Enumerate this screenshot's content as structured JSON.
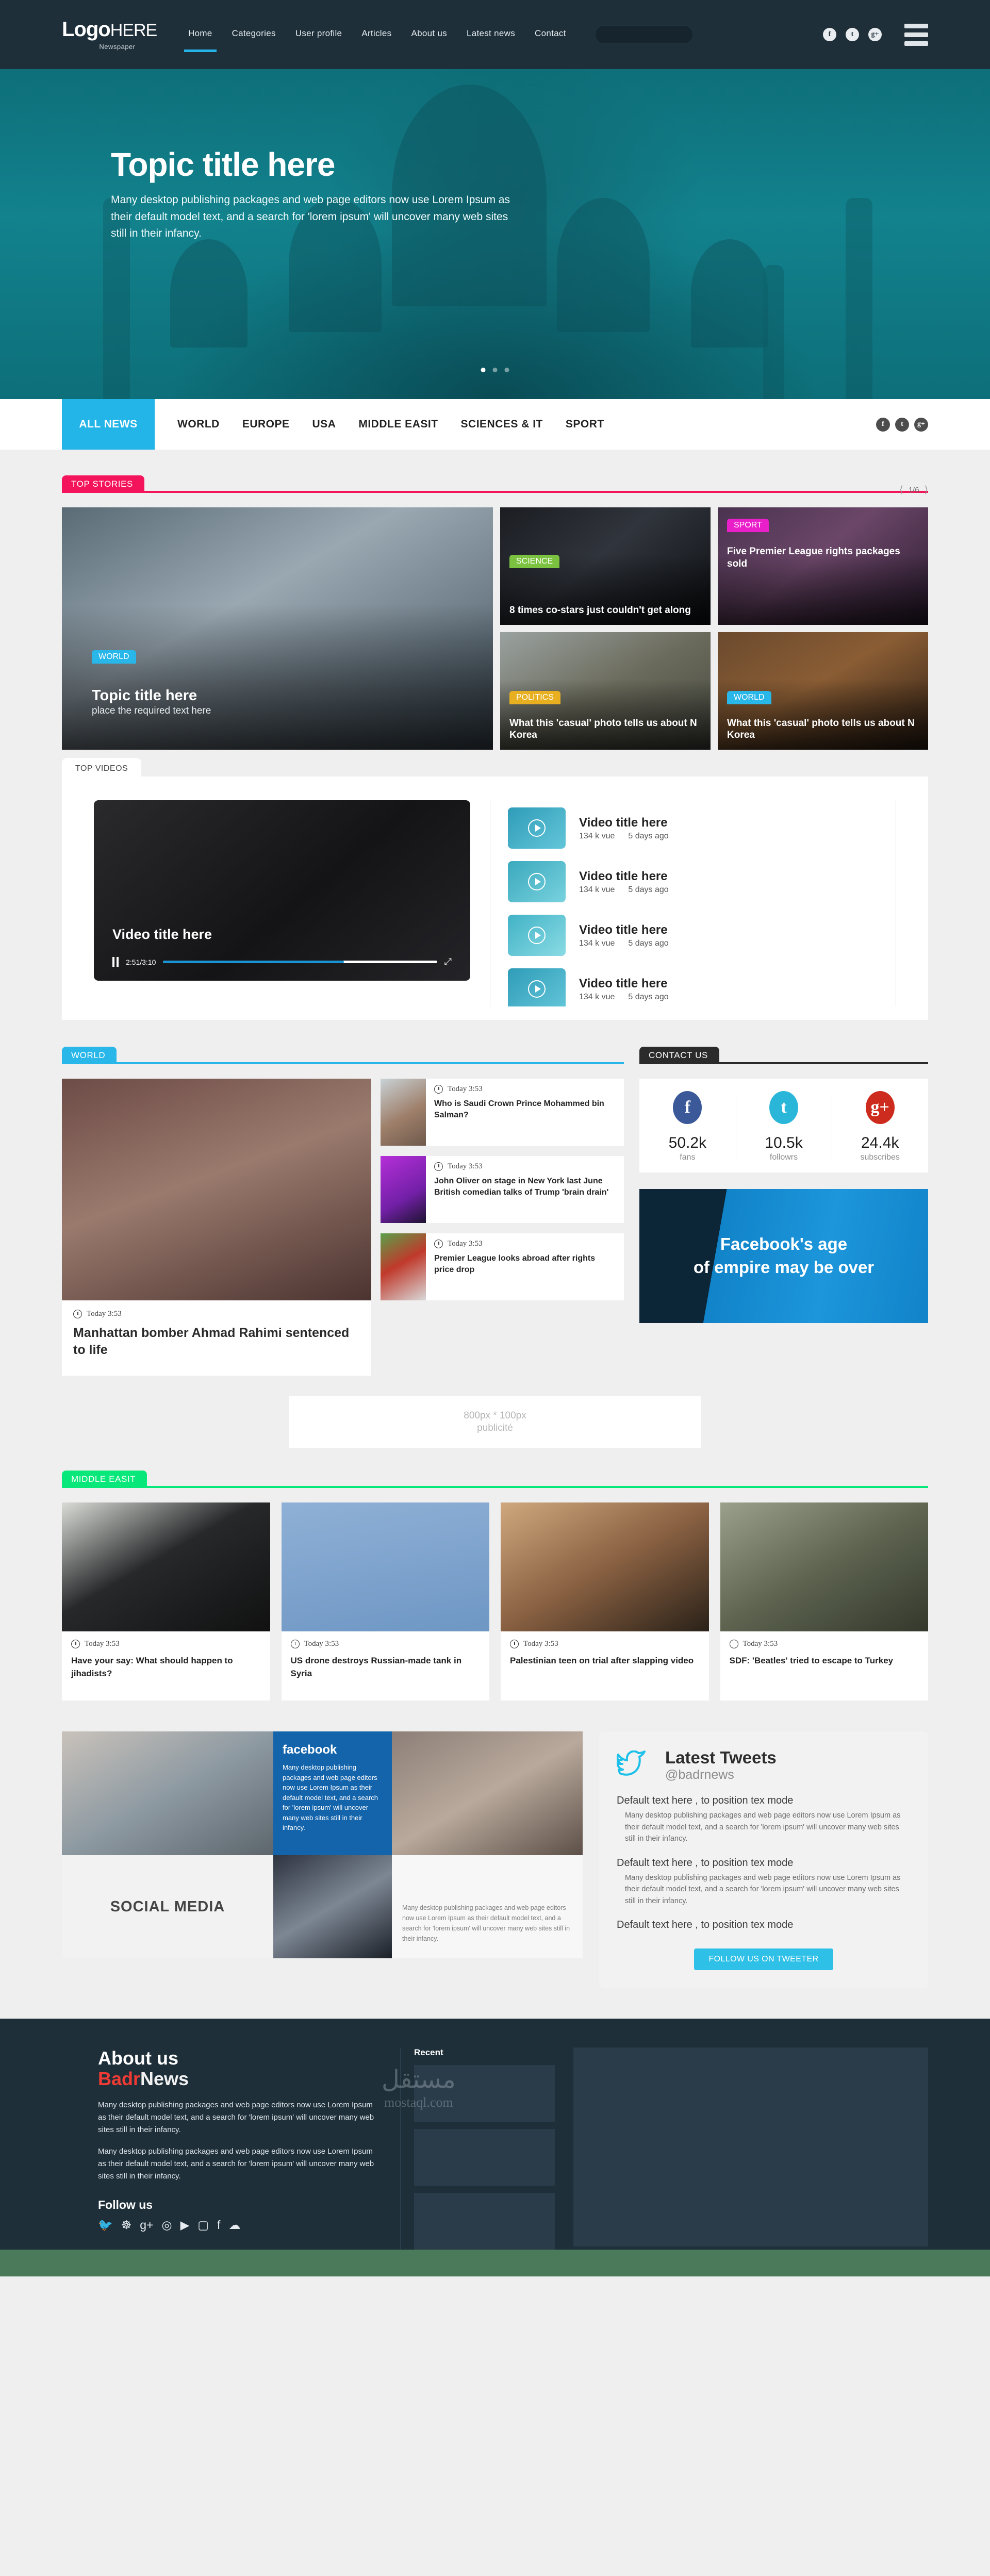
{
  "header": {
    "logo_main": "Logo",
    "logo_main_light": "HERE",
    "logo_sub": "Newspaper",
    "nav": [
      {
        "label": "Home",
        "active": true
      },
      {
        "label": "Categories",
        "active": false
      },
      {
        "label": "User profile",
        "active": false
      },
      {
        "label": "Articles",
        "active": false
      },
      {
        "label": "About us",
        "active": false
      },
      {
        "label": "Latest news",
        "active": false
      },
      {
        "label": "Contact",
        "active": false
      }
    ],
    "search_placeholder": "",
    "socials": [
      "f",
      "t",
      "g+"
    ]
  },
  "hero": {
    "title": "Topic title here",
    "text": "Many desktop publishing packages and web page editors now use Lorem Ipsum  as their default model text, and a search  for 'lorem ipsum' will uncover many web sites still in their infancy.",
    "dots": 3,
    "active_dot": 0
  },
  "categorybar": {
    "active": "ALL NEWS",
    "items": [
      "WORLD",
      "EUROPE",
      "USA",
      "MIDDLE EASIT",
      "SCIENCES & IT",
      "SPORT"
    ],
    "socials": [
      "f",
      "t",
      "g+"
    ]
  },
  "top_stories": {
    "tab": "TOP STORIES",
    "accent": "#f4145b",
    "pager": "1/6",
    "main": {
      "badge": "WORLD",
      "badge_color": "#29b6e8",
      "title": "Topic title here",
      "subtitle": "place the required text here"
    },
    "cards": [
      {
        "badge": "SCIENCE",
        "badge_color": "#7cc241",
        "title": "8 times co-stars just couldn't get along"
      },
      {
        "badge": "SPORT",
        "badge_color": "#e91fc9",
        "title": "Five Premier League rights packages sold"
      },
      {
        "badge": "POLITICS",
        "badge_color": "#e8b020",
        "title": "What this 'casual' photo tells us about N Korea"
      },
      {
        "badge": "WORLD",
        "badge_color": "#29b6e8",
        "title": "What this 'casual' photo tells us about N Korea"
      }
    ]
  },
  "videos": {
    "tab": "TOP VIDEOS",
    "player": {
      "title": "Video title here",
      "time": "2:51/3:10",
      "progress": 66
    },
    "list": [
      {
        "title": "Video title here",
        "views": "134 k vue",
        "age": "5 days ago"
      },
      {
        "title": "Video title here",
        "views": "134 k vue",
        "age": "5 days ago"
      },
      {
        "title": "Video title here",
        "views": "134 k vue",
        "age": "5 days ago"
      },
      {
        "title": "Video title here",
        "views": "134 k vue",
        "age": "5 days ago"
      }
    ]
  },
  "world": {
    "tab": "WORLD",
    "accent": "#29b6e8",
    "feature": {
      "time": "Today 3:53",
      "title": "Manhattan bomber Ahmad Rahimi sentenced to life"
    },
    "items": [
      {
        "time": "Today 3:53",
        "title": "Who is Saudi Crown Prince Mohammed bin Salman?"
      },
      {
        "time": "Today 3:53",
        "title": "John Oliver on stage in New York last June British comedian talks of Trump 'brain drain'"
      },
      {
        "time": "Today 3:53",
        "title": "Premier League looks abroad after rights price drop"
      }
    ]
  },
  "contact": {
    "tab": "CONTACT US",
    "accent": "#2b2b2b",
    "stats": [
      {
        "icon": "f",
        "color": "#3b5998",
        "value": "50.2k",
        "label": "fans"
      },
      {
        "icon": "t",
        "color": "#29b6d8",
        "value": "10.5k",
        "label": "followrs"
      },
      {
        "icon": "g+",
        "color": "#cc2b1d",
        "value": "24.4k",
        "label": "subscribes"
      }
    ],
    "banner": {
      "line1": "Facebook's age",
      "line2": "of empire may be over"
    }
  },
  "ad": {
    "size": "800px * 100px",
    "label": "publicité"
  },
  "middle_east": {
    "tab": "MIDDLE EASIT",
    "accent": "#08e87a",
    "cards": [
      {
        "time": "Today 3:53",
        "title": "Have your say: What should happen to jihadists?"
      },
      {
        "time": "Today 3:53",
        "title": "US drone destroys Russian-made tank in Syria"
      },
      {
        "time": "Today 3:53",
        "title": "Palestinian teen on trial after slapping video"
      },
      {
        "time": "Today 3:53",
        "title": "SDF: 'Beatles' tried to escape to Turkey"
      }
    ]
  },
  "social_media": {
    "title": "SOCIAL MEDIA",
    "facebook_title": "facebook",
    "facebook_text": "Many desktop publishing  packages and web page editors now use Lorem Ipsum  as  their default model text, and a search  for 'lorem ipsum' will uncover many web  sites still in their infancy.",
    "side_text": "Many desktop publishing  packages and web page editors now use Lorem Ipsum  as  their default model text, and a search  for 'lorem ipsum'  will uncover many web  sites still in their infancy."
  },
  "tweets": {
    "title": "Latest Tweets",
    "handle": "@badrnews",
    "items": [
      {
        "headline": "Default text here , to position tex mode",
        "body": "Many desktop publishing packages and web page editors now use Lorem Ipsum  as their default model text, and a search  for 'lorem ipsum' will uncover many web sites still in their infancy."
      },
      {
        "headline": "Default text here , to position tex mode",
        "body": "Many desktop publishing packages and web page editors now use Lorem Ipsum  as their default model text, and a search  for 'lorem ipsum' will uncover many web sites still in their infancy."
      },
      {
        "headline": "Default text here , to position tex mode",
        "body": ""
      }
    ],
    "button": "FOLLOW US ON TWEETER"
  },
  "footer": {
    "about_title": "About us",
    "brand_red": "Badr",
    "brand_white": "News",
    "para1": "Many desktop publishing packages and web page editors now use Lorem Ipsum  as their default model text, and a search  for 'lorem ipsum' will uncover many web sites still in their infancy.",
    "para2": "Many desktop publishing packages and web page editors now use Lorem Ipsum  as their default model text, and a search  for 'lorem ipsum' will uncover many web sites still in their infancy.",
    "follow_title": "Follow us",
    "follow_icons": [
      "twitter",
      "snapchat",
      "google-plus",
      "spotify",
      "vimeo",
      "instagram",
      "facebook",
      "soundcloud"
    ],
    "recent_title": "Recent",
    "watermark_ar": "مستقل",
    "watermark_en": "mostaql.com"
  }
}
